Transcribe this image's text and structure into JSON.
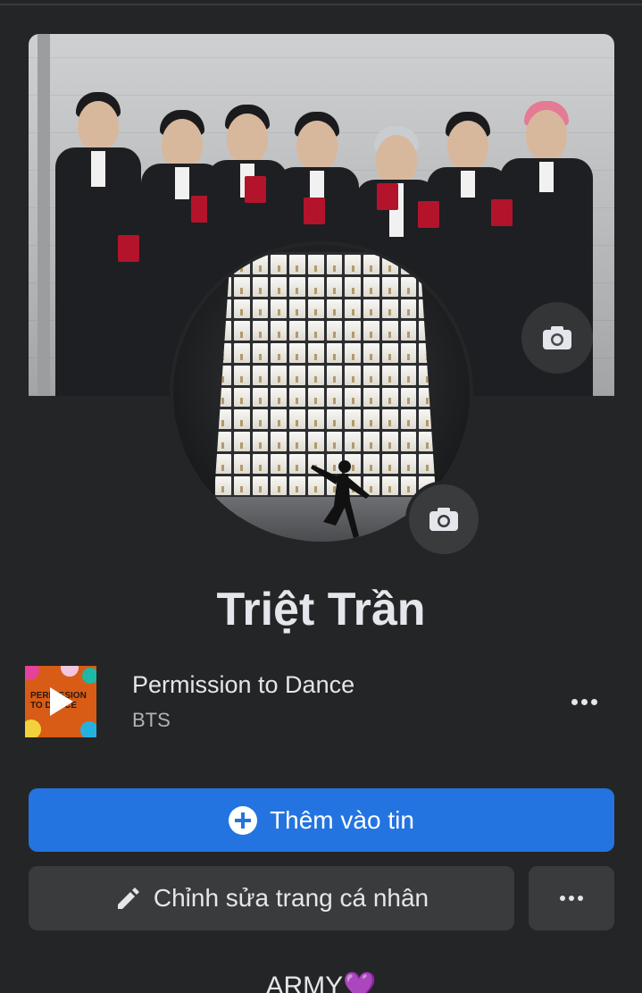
{
  "profile": {
    "name": "Triệt Trần",
    "bio_text": "ARMY",
    "bio_emoji": "💜"
  },
  "music": {
    "song_title": "Permission to Dance",
    "artist": "BTS",
    "album_art_text": "PERMISSION TO DANCE"
  },
  "actions": {
    "add_to_story_label": "Thêm vào tin",
    "edit_profile_label": "Chỉnh sửa trang cá nhân"
  },
  "icons": {
    "cover_camera": "camera-icon",
    "avatar_camera": "camera-icon",
    "play": "play-icon",
    "more": "more-horizontal-icon",
    "plus": "plus-circle-icon",
    "pencil": "pencil-icon"
  },
  "colors": {
    "background": "#242526",
    "primary_button": "#2374e1",
    "secondary_button": "#3a3b3c",
    "text_primary": "#e4e6eb",
    "text_secondary": "#b0b3b8",
    "heart": "#8e44e8"
  }
}
